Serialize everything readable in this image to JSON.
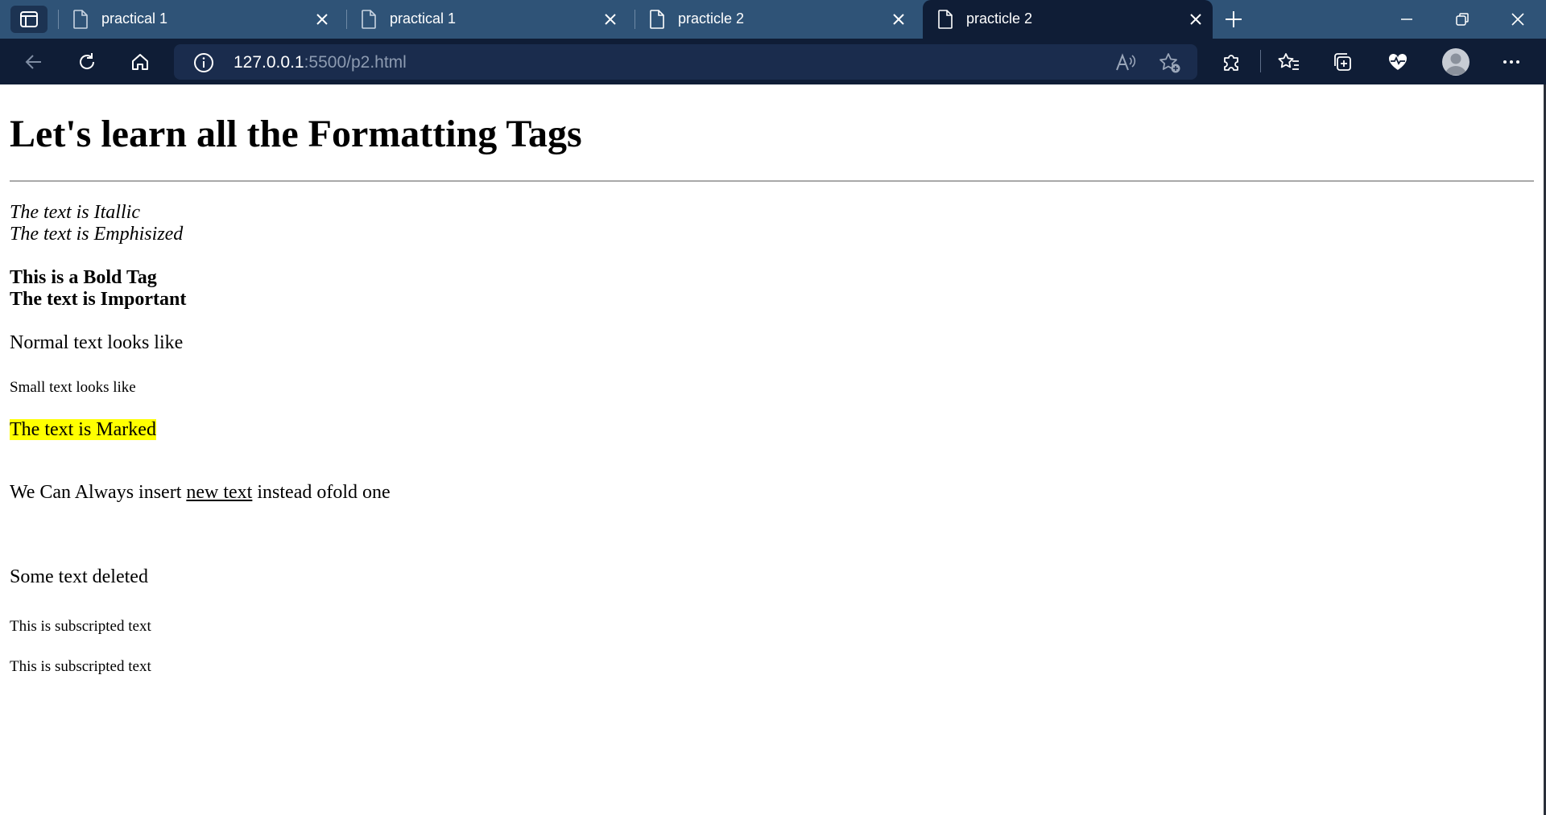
{
  "browser": {
    "tabs": [
      {
        "title": "practical 1",
        "active": false
      },
      {
        "title": "practical 1",
        "active": false
      },
      {
        "title": "practicle 2",
        "active": false
      },
      {
        "title": "practicle 2",
        "active": true
      }
    ],
    "address": {
      "host": "127.0.0.1",
      "rest": ":5500/p2.html"
    },
    "icons": {
      "tab_actions": "tab-actions-icon",
      "file": "file-icon",
      "close": "close-icon",
      "new_tab": "plus-icon",
      "minimize": "minimize-icon",
      "restore": "restore-icon",
      "window_close": "window-close-icon",
      "back": "back-arrow-icon",
      "refresh": "refresh-icon",
      "home": "home-icon",
      "info": "info-icon",
      "read_aloud": "read-aloud-icon",
      "favorite_add": "star-add-icon",
      "extensions": "puzzle-icon",
      "favorites": "favorites-icon",
      "collections": "collections-icon",
      "health": "heart-pulse-icon",
      "profile": "avatar-icon",
      "more": "more-icon"
    },
    "colors": {
      "tab_strip": "#2f5377",
      "toolbar": "#0f1d36",
      "address_box": "#1a2c4d",
      "mark_highlight": "#ffff00"
    }
  },
  "page": {
    "heading": "Let's learn all the Formatting Tags",
    "italic_text": "The text is Itallic",
    "emphasized_text": "The text is Emphisized",
    "bold_text": "This is a Bold Tag",
    "important_text": "The text is Important",
    "normal_text": "Normal text looks like",
    "small_text": "Small text looks like",
    "marked_text": "The text is Marked",
    "insert_before": "We Can Always insert",
    "insert_new": "new text",
    "insert_after": "instead ofold one",
    "deleted_text": "Some text deleted",
    "subscript_text_1": "This is subscripted text",
    "subscript_text_2": "This is subscripted text"
  }
}
